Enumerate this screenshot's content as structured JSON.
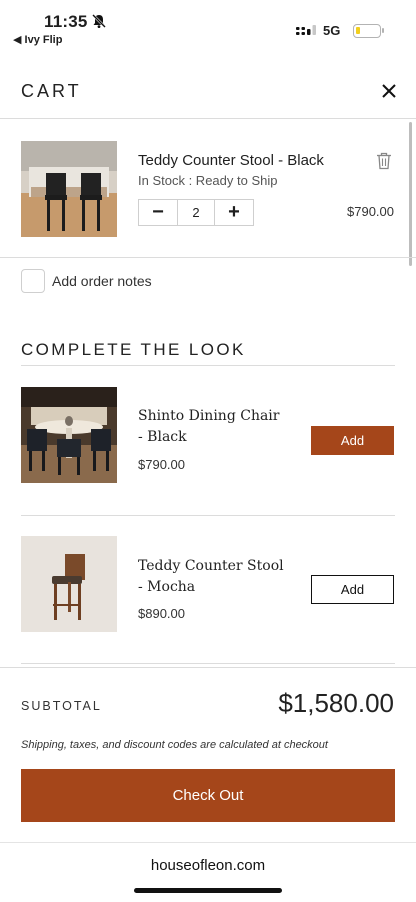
{
  "status_bar": {
    "time": "11:35",
    "back_app": "◀ Ivy Flip",
    "network": "5G",
    "battery_level": 0.2
  },
  "cart": {
    "title": "CART",
    "item": {
      "name": "Teddy Counter Stool - Black",
      "stock": "In Stock : Ready to Ship",
      "quantity": "2",
      "decrease_label": "−",
      "increase_label": "+",
      "price": "$790.00"
    },
    "notes_label": "Add order notes"
  },
  "complete_the_look": {
    "title": "COMPLETE THE LOOK",
    "items": [
      {
        "name": "Shinto Dining Chair - Black",
        "price": "$790.00",
        "button": "Add"
      },
      {
        "name": "Teddy Counter Stool - Mocha",
        "price": "$890.00",
        "button": "Add"
      }
    ]
  },
  "footer": {
    "subtotal_label": "SUBTOTAL",
    "subtotal_value": "$1,580.00",
    "shipping_note": "Shipping, taxes, and discount codes are calculated at checkout",
    "checkout_label": "Check Out"
  },
  "browser": {
    "url": "houseofleon.com"
  },
  "colors": {
    "accent": "#a5461a",
    "divider": "#dcdcdc"
  },
  "icons": [
    "bell-slash-icon",
    "signal-icon",
    "battery-icon",
    "close-icon",
    "trash-icon"
  ]
}
